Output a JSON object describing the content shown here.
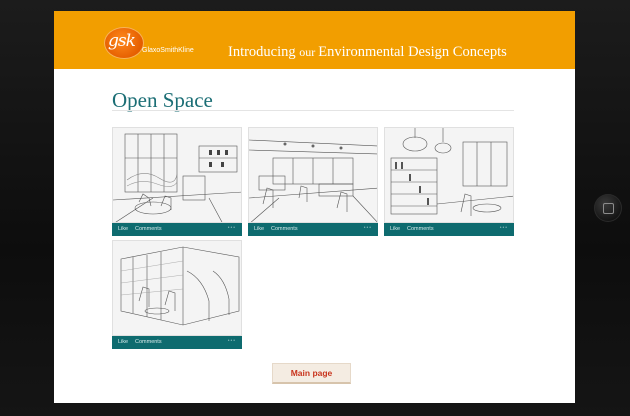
{
  "header": {
    "logo_mark": "gsk",
    "logo_text": "GlaxoSmithKline",
    "title_part1": "Introducing ",
    "title_part2": "our ",
    "title_part3": "Environmental Design Concepts"
  },
  "page": {
    "title": "Open Space"
  },
  "gallery": {
    "cards": [
      {
        "like": "Like",
        "comments": "Comments",
        "more": "•••"
      },
      {
        "like": "Like",
        "comments": "Comments",
        "more": "•••"
      },
      {
        "like": "Like",
        "comments": "Comments",
        "more": "•••"
      },
      {
        "like": "Like",
        "comments": "Comments",
        "more": "•••"
      }
    ]
  },
  "footer": {
    "main_button": "Main page"
  },
  "colors": {
    "brand_orange": "#f29e00",
    "teal": "#0e6b6f",
    "title_teal": "#1b6e75",
    "button_text": "#c8341d"
  },
  "icons": {
    "home_button": "home-button-icon",
    "logo": "gsk-logo-icon"
  }
}
